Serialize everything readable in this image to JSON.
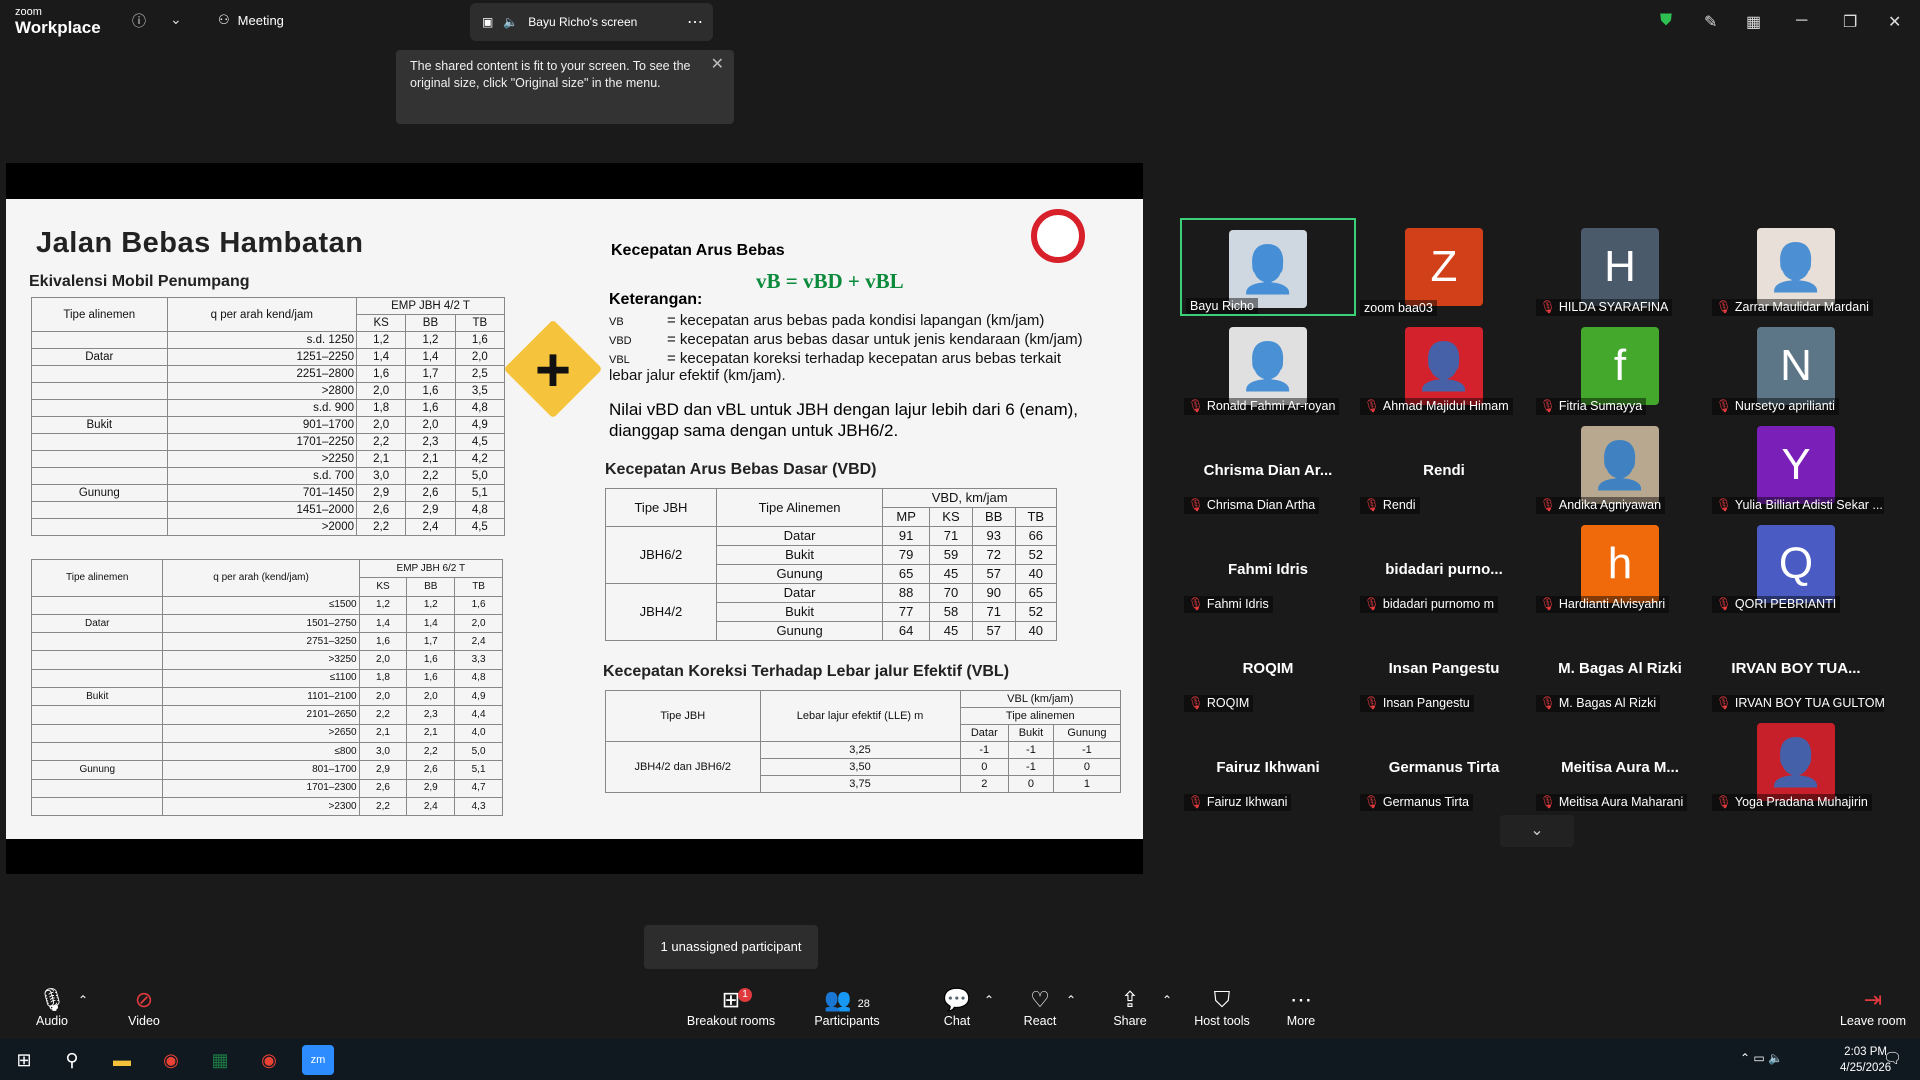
{
  "topbar": {
    "logo_small": "zoom",
    "logo_big": "Workplace",
    "meeting_label": "Meeting",
    "screen_tab": "Bayu Richo's screen"
  },
  "tooltip": {
    "text": "The shared content is fit to your screen. To see the original size, click \"Original size\" in the menu."
  },
  "slide": {
    "title": "Jalan Bebas Hambatan",
    "subtitle": "Ekivalensi Mobil Penumpang",
    "t1_head": [
      "Tipe alinemen",
      "q per arah kend/jam",
      "EMP JBH 4/2 T",
      "KS",
      "BB",
      "TB"
    ],
    "t1_rows": [
      [
        "",
        "s.d. 1250",
        "1,2",
        "1,2",
        "1,6"
      ],
      [
        "Datar",
        "1251–2250",
        "1,4",
        "1,4",
        "2,0"
      ],
      [
        "",
        "2251–2800",
        "1,6",
        "1,7",
        "2,5"
      ],
      [
        "",
        ">2800",
        "2,0",
        "1,6",
        "3,5"
      ],
      [
        "",
        "s.d. 900",
        "1,8",
        "1,6",
        "4,8"
      ],
      [
        "Bukit",
        "901–1700",
        "2,0",
        "2,0",
        "4,9"
      ],
      [
        "",
        "1701–2250",
        "2,2",
        "2,3",
        "4,5"
      ],
      [
        "",
        ">2250",
        "2,1",
        "2,1",
        "4,2"
      ],
      [
        "",
        "s.d. 700",
        "3,0",
        "2,2",
        "5,0"
      ],
      [
        "Gunung",
        "701–1450",
        "2,9",
        "2,6",
        "5,1"
      ],
      [
        "",
        "1451–2000",
        "2,6",
        "2,9",
        "4,8"
      ],
      [
        "",
        ">2000",
        "2,2",
        "2,4",
        "4,5"
      ]
    ],
    "t2_head": [
      "Tipe alinemen",
      "q per arah (kend/jam)",
      "EMP JBH 6/2 T",
      "KS",
      "BB",
      "TB"
    ],
    "t2_rows": [
      [
        "",
        "≤1500",
        "1,2",
        "1,2",
        "1,6"
      ],
      [
        "Datar",
        "1501–2750",
        "1,4",
        "1,4",
        "2,0"
      ],
      [
        "",
        "2751–3250",
        "1,6",
        "1,7",
        "2,4"
      ],
      [
        "",
        ">3250",
        "2,0",
        "1,6",
        "3,3"
      ],
      [
        "",
        "≤1100",
        "1,8",
        "1,6",
        "4,8"
      ],
      [
        "Bukit",
        "1101–2100",
        "2,0",
        "2,0",
        "4,9"
      ],
      [
        "",
        "2101–2650",
        "2,2",
        "2,3",
        "4,4"
      ],
      [
        "",
        ">2650",
        "2,1",
        "2,1",
        "4,0"
      ],
      [
        "",
        "≤800",
        "3,0",
        "2,2",
        "5,0"
      ],
      [
        "Gunung",
        "801–1700",
        "2,9",
        "2,6",
        "5,1"
      ],
      [
        "",
        "1701–2300",
        "2,6",
        "2,9",
        "4,7"
      ],
      [
        "",
        ">2300",
        "2,2",
        "2,4",
        "4,3"
      ]
    ],
    "kab_title": "Kecepatan Arus Bebas",
    "formula": "vB = vBD + vBL",
    "ket_label": "Keterangan:",
    "ket": [
      {
        "sym": "VB",
        "desc": "= kecepatan arus bebas pada kondisi lapangan (km/jam)"
      },
      {
        "sym": "VBD",
        "desc": "= kecepatan arus bebas dasar untuk jenis kendaraan (km/jam)"
      },
      {
        "sym": "VBL",
        "desc": "= kecepatan koreksi terhadap kecepatan arus bebas terkait lebar jalur efektif (km/jam)."
      }
    ],
    "nilai": "Nilai vBD dan vBL untuk JBH dengan lajur lebih dari 6 (enam), dianggap sama dengan untuk JBH6/2.",
    "kabd_title": "Kecepatan Arus Bebas Dasar (VBD)",
    "t3_head": [
      "Tipe JBH",
      "Tipe Alinemen",
      "VBD, km/jam",
      "MP",
      "KS",
      "BB",
      "TB"
    ],
    "t3_rows": [
      [
        "JBH6/2",
        "Datar",
        "91",
        "71",
        "93",
        "66"
      ],
      [
        "",
        "Bukit",
        "79",
        "59",
        "72",
        "52"
      ],
      [
        "",
        "Gunung",
        "65",
        "45",
        "57",
        "40"
      ],
      [
        "JBH4/2",
        "Datar",
        "88",
        "70",
        "90",
        "65"
      ],
      [
        "",
        "Bukit",
        "77",
        "58",
        "71",
        "52"
      ],
      [
        "",
        "Gunung",
        "64",
        "45",
        "57",
        "40"
      ]
    ],
    "kk_title": "Kecepatan Koreksi Terhadap Lebar jalur Efektif (VBL)",
    "t4_head": [
      "Tipe JBH",
      "Lebar lajur efektif (LLE) m",
      "VBL (km/jam)",
      "Tipe alinemen",
      "Datar",
      "Bukit",
      "Gunung"
    ],
    "t4_label": "JBH4/2 dan JBH6/2",
    "t4_rows": [
      [
        "3,25",
        "-1",
        "-1",
        "-1"
      ],
      [
        "3,50",
        "0",
        "-1",
        "0"
      ],
      [
        "3,75",
        "2",
        "0",
        "1"
      ]
    ]
  },
  "participants": [
    {
      "name": "Bayu Richo",
      "avatar": "photo",
      "color": "#cfd8e0",
      "initial": "",
      "muted": false,
      "big": ""
    },
    {
      "name": "zoom baa03",
      "avatar": "letter",
      "color": "#d2401a",
      "initial": "Z",
      "muted": false,
      "big": ""
    },
    {
      "name": "HILDA SYARAFINA",
      "avatar": "letter",
      "color": "#4a5a6a",
      "initial": "H",
      "muted": true,
      "big": ""
    },
    {
      "name": "Zarrar Maulidar Mardani",
      "avatar": "photo",
      "color": "#e8e0d8",
      "initial": "",
      "muted": true,
      "big": ""
    },
    {
      "name": "Ronald Fahmi Ar-royan",
      "avatar": "photo",
      "color": "#e0e0e0",
      "initial": "",
      "muted": true,
      "big": ""
    },
    {
      "name": "Ahmad Majidul Himam",
      "avatar": "photo",
      "color": "#d4222c",
      "initial": "",
      "muted": true,
      "big": ""
    },
    {
      "name": "Fitria Sumayya",
      "avatar": "letter",
      "color": "#43a82c",
      "initial": "f",
      "muted": true,
      "big": ""
    },
    {
      "name": "Nursetyo aprilianti",
      "avatar": "letter",
      "color": "#5c7688",
      "initial": "N",
      "muted": true,
      "big": ""
    },
    {
      "name": "Chrisma Dian Artha",
      "avatar": "none",
      "color": "",
      "initial": "",
      "muted": true,
      "big": "Chrisma Dian Ar..."
    },
    {
      "name": "Rendi",
      "avatar": "none",
      "color": "",
      "initial": "",
      "muted": true,
      "big": "Rendi"
    },
    {
      "name": "Andika Agniyawan",
      "avatar": "photo",
      "color": "#b8a890",
      "initial": "",
      "muted": true,
      "big": ""
    },
    {
      "name": "Yulia Billiart Adisti Sekar ...",
      "avatar": "letter",
      "color": "#7a1fb8",
      "initial": "Y",
      "muted": true,
      "big": ""
    },
    {
      "name": "Fahmi Idris",
      "avatar": "none",
      "color": "",
      "initial": "",
      "muted": true,
      "big": "Fahmi Idris"
    },
    {
      "name": "bidadari purnomo m",
      "avatar": "none",
      "color": "",
      "initial": "",
      "muted": true,
      "big": "bidadari  purno..."
    },
    {
      "name": "Hardianti Alvisyahri",
      "avatar": "letter",
      "color": "#f06a0c",
      "initial": "h",
      "muted": true,
      "big": ""
    },
    {
      "name": "QORI PEBRIANTI",
      "avatar": "letter",
      "color": "#4a5bc4",
      "initial": "Q",
      "muted": true,
      "big": ""
    },
    {
      "name": "ROQIM",
      "avatar": "none",
      "color": "",
      "initial": "",
      "muted": true,
      "big": "ROQIM"
    },
    {
      "name": "Insan Pangestu",
      "avatar": "none",
      "color": "",
      "initial": "",
      "muted": true,
      "big": "Insan Pangestu"
    },
    {
      "name": "M. Bagas Al Rizki",
      "avatar": "none",
      "color": "",
      "initial": "",
      "muted": true,
      "big": "M. Bagas Al Rizki"
    },
    {
      "name": "IRVAN BOY TUA GULTOM",
      "avatar": "none",
      "color": "",
      "initial": "",
      "muted": true,
      "big": "IRVAN BOY TUA..."
    },
    {
      "name": "Fairuz Ikhwani",
      "avatar": "none",
      "color": "",
      "initial": "",
      "muted": true,
      "big": "Fairuz Ikhwani"
    },
    {
      "name": "Germanus Tirta",
      "avatar": "none",
      "color": "",
      "initial": "",
      "muted": true,
      "big": "Germanus Tirta"
    },
    {
      "name": "Meitisa Aura Maharani",
      "avatar": "none",
      "color": "",
      "initial": "",
      "muted": true,
      "big": "Meitisa  Aura  M..."
    },
    {
      "name": "Yoga Pradana Muhajirin",
      "avatar": "photo",
      "color": "#c8202a",
      "initial": "",
      "muted": true,
      "big": ""
    }
  ],
  "unassigned": "1 unassigned participant",
  "toolbar": {
    "audio": "Audio",
    "video": "Video",
    "breakout": "Breakout rooms",
    "breakout_badge": "1",
    "participants": "Participants",
    "participants_count": "28",
    "chat": "Chat",
    "react": "React",
    "share": "Share",
    "host": "Host tools",
    "more": "More",
    "leave": "Leave room"
  },
  "taskbar": {
    "time": "2:03 PM",
    "date": "4/25/2026"
  }
}
